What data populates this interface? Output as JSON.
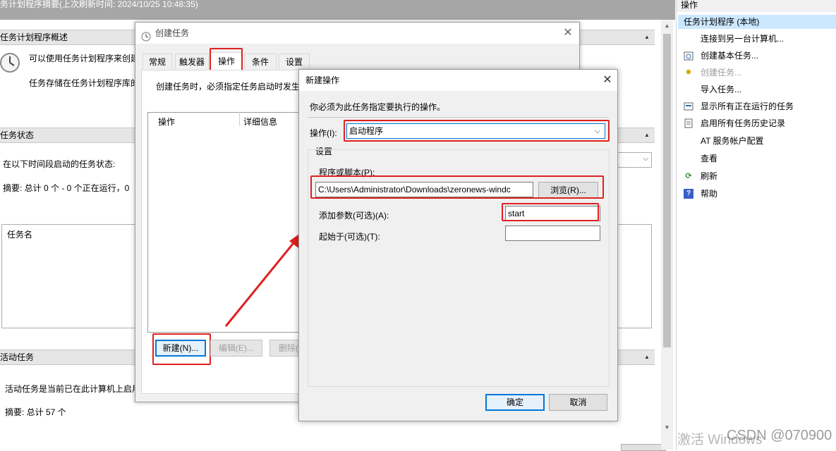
{
  "topbar": {
    "text": "务计划程序摘要(上次刷新时间: 2024/10/25 10:48:35)"
  },
  "sections": {
    "overview": {
      "title": "任务计划程序概述",
      "line1": "可以使用任务计划程序来创建",
      "line2": "任务存储在任务计划程序库的"
    },
    "status": {
      "title": "任务状态",
      "prompt": "在以下时间段启动的任务状态:",
      "summary": "摘要: 总计 0 个 - 0 个正在运行，0",
      "column": "任务名"
    },
    "active": {
      "title": "活动任务",
      "desc": "活动任务是当前已在此计算机上启用",
      "summary": "摘要: 总计 57 个"
    }
  },
  "right_pane": {
    "header": "操作",
    "selected": "任务计划程序 (本地)",
    "items": [
      {
        "label": "连接到另一台计算机...",
        "icon": ""
      },
      {
        "label": "创建基本任务...",
        "icon": "basic-task-icon"
      },
      {
        "label": "创建任务...",
        "icon": "create-task-icon",
        "disabled": true
      },
      {
        "label": "导入任务...",
        "icon": ""
      },
      {
        "label": "显示所有正在运行的任务",
        "icon": "running-tasks-icon"
      },
      {
        "label": "启用所有任务历史记录",
        "icon": "history-icon"
      },
      {
        "label": "AT 服务帐户配置",
        "icon": ""
      },
      {
        "label": "查看",
        "icon": ""
      },
      {
        "label": "刷新",
        "icon": "refresh-icon"
      },
      {
        "label": "帮助",
        "icon": "help-icon"
      }
    ]
  },
  "create_task": {
    "title": "创建任务",
    "tabs": [
      "常规",
      "触发器",
      "操作",
      "条件",
      "设置"
    ],
    "active_tab": "操作",
    "hint": "创建任务时，必须指定任务启动时发生",
    "columns": [
      "操作",
      "详细信息"
    ],
    "buttons": {
      "new": "新建(N)...",
      "edit": "编辑(E)...",
      "delete": "删除("
    }
  },
  "new_action": {
    "title": "新建操作",
    "description": "你必须为此任务指定要执行的操作。",
    "action_label": "操作(I):",
    "action_value": "启动程序",
    "settings_label": "设置",
    "program_label": "程序或脚本(P):",
    "program_value": "C:\\Users\\Administrator\\Downloads\\zeronews-windc",
    "browse": "浏览(R)...",
    "args_label": "添加参数(可选)(A):",
    "args_value": "start",
    "startin_label": "起始于(可选)(T):",
    "startin_value": "",
    "ok": "确定",
    "cancel": "取消"
  },
  "watermark": "激活 Windows",
  "watermark2": "CSDN @070900"
}
